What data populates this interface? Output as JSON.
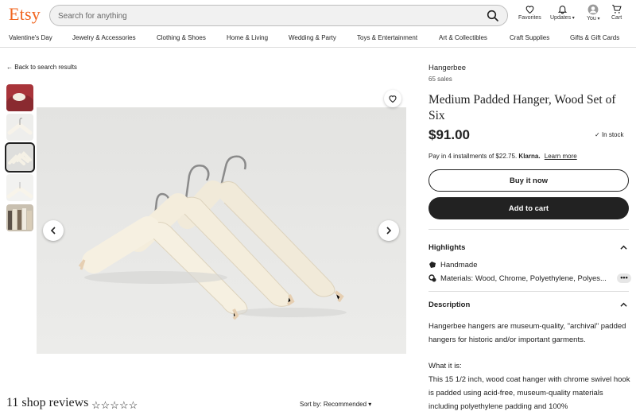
{
  "header": {
    "logo": "Etsy",
    "search_placeholder": "Search for anything",
    "favorites": "Favorites",
    "updates": "Updates",
    "you": "You",
    "cart": "Cart"
  },
  "categories": [
    "Valentine's Day",
    "Jewelry & Accessories",
    "Clothing & Shoes",
    "Home & Living",
    "Wedding & Party",
    "Toys & Entertainment",
    "Art & Collectibles",
    "Craft Supplies",
    "Gifts & Gift Cards"
  ],
  "gallery": {
    "back_link": "Back to search results",
    "reviews_title": "11 shop reviews",
    "stars": "☆☆☆☆☆",
    "sort_label": "Sort by:",
    "sort_value": "Recommended"
  },
  "listing": {
    "shop_name": "Hangerbee",
    "sales": "65 sales",
    "title": "Medium Padded Hanger, Wood Set of Six",
    "price": "$91.00",
    "stock": "In stock",
    "klarna_text": "Pay in 4 installments of $22.75.",
    "klarna_brand": "Klarna.",
    "klarna_link": "Learn more",
    "buy_now": "Buy it now",
    "add_to_cart": "Add to cart",
    "highlights_title": "Highlights",
    "highlight_1": "Handmade",
    "highlight_2": "Materials: Wood, Chrome, Polyethylene, Polyes...",
    "more_dots": "•••",
    "description_title": "Description",
    "desc_p1": "Hangerbee hangers are museum-quality, \"archival\" padded hangers for historic and/or important garments.",
    "desc_p2_head": "What it is:",
    "desc_p2": "This 15 1/2 inch, wood coat hanger with chrome swivel hook is padded using acid-free, museum-quality materials including polyethylene padding and 100%"
  },
  "colors": {
    "brand": "#F1641E",
    "dark": "#222222"
  }
}
